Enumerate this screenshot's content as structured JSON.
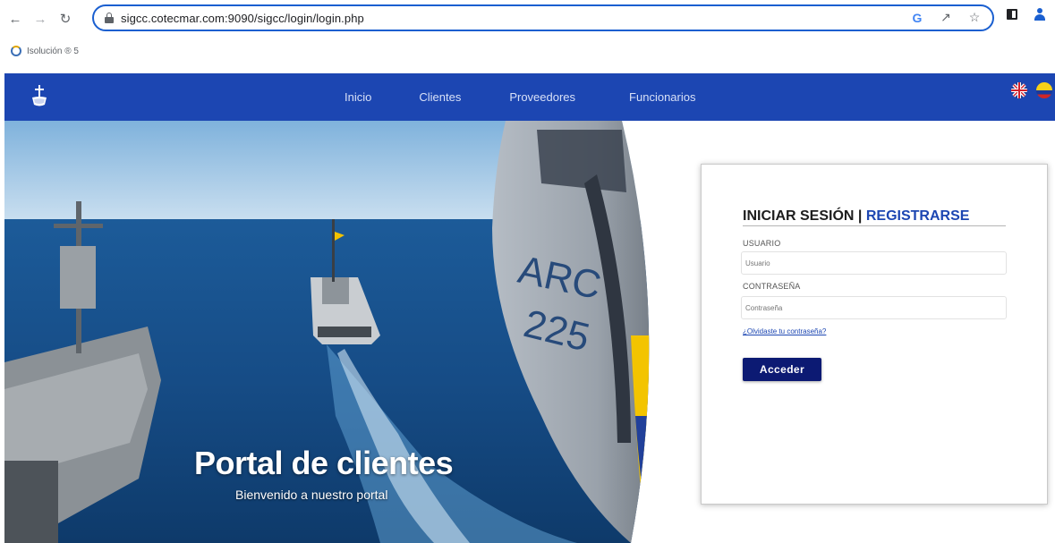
{
  "browser": {
    "url": "sigcc.cotecmar.com:9090/sigcc/login/login.php",
    "bookmark_label": "Isolución ® 5",
    "icons": [
      "back-icon",
      "forward-icon",
      "reload-icon",
      "lock-icon",
      "google-icon",
      "share-icon",
      "star-icon",
      "side-panel-icon",
      "profile-icon"
    ]
  },
  "header": {
    "nav": [
      "Inicio",
      "Clientes",
      "Proveedores",
      "Funcionarios"
    ],
    "brand_color": "#1c46b2",
    "languages": [
      "english-flag-icon",
      "colombia-flag-icon"
    ]
  },
  "hero": {
    "title": "Portal de clientes",
    "subtitle": "Bienvenido a nuestro portal"
  },
  "login": {
    "heading_login": "INICIAR SESIÓN",
    "heading_separator": " | ",
    "heading_register": "REGISTRARSE",
    "user_label": "USUARIO",
    "user_placeholder": "Usuario",
    "pass_label": "CONTRASEÑA",
    "pass_placeholder": "Contraseña",
    "forgot_label": "¿Olvidaste tu contraseña?",
    "submit_label": "Acceder",
    "submit_color": "#0c1a73"
  }
}
